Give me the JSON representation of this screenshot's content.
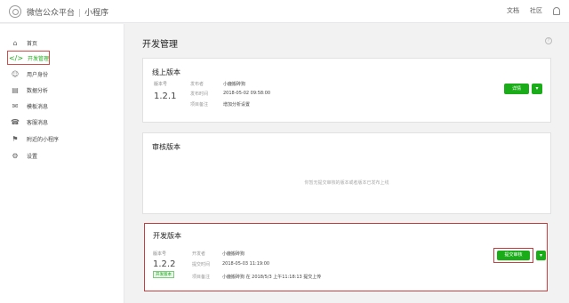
{
  "header": {
    "brand": "微信公众平台",
    "product": "小程序",
    "links": [
      "文档",
      "社区"
    ]
  },
  "sidebar": {
    "items": [
      {
        "label": "首页",
        "icon": "home-icon"
      },
      {
        "label": "开发管理",
        "icon": "code-icon"
      },
      {
        "label": "用户身份",
        "icon": "user-icon"
      },
      {
        "label": "数据分析",
        "icon": "chart-icon"
      },
      {
        "label": "模板消息",
        "icon": "message-icon"
      },
      {
        "label": "客服消息",
        "icon": "service-icon"
      },
      {
        "label": "附近的小程序",
        "icon": "location-icon"
      },
      {
        "label": "设置",
        "icon": "gear-icon"
      }
    ],
    "active_index": 1
  },
  "main": {
    "title": "开发管理",
    "online": {
      "title": "线上版本",
      "version_label": "版本号",
      "version": "1.2.1",
      "fields": [
        {
          "label": "发布者",
          "value": "小鹿搬砖狗"
        },
        {
          "label": "发布时间",
          "value": "2018-05-02 09:58:00"
        },
        {
          "label": "项目备注",
          "value": "增加分析设置"
        }
      ],
      "detail_button": "详情"
    },
    "review": {
      "title": "审核版本",
      "empty_text": "你暂无提交审核的版本或者版本已发布上线"
    },
    "dev": {
      "title": "开发版本",
      "version_label": "版本号",
      "version": "1.2.2",
      "tag": "开发版本",
      "fields": [
        {
          "label": "开发者",
          "value": "小鹿搬砖狗"
        },
        {
          "label": "提交时间",
          "value": "2018-05-03 11:19:00"
        },
        {
          "label": "项目备注",
          "value": "小鹿搬砖狗 在 2018/5/3 上午11:18:13 提交上传"
        }
      ],
      "submit_button": "提交审核"
    }
  },
  "colors": {
    "accent": "#1aad19",
    "highlight": "#c64040"
  }
}
